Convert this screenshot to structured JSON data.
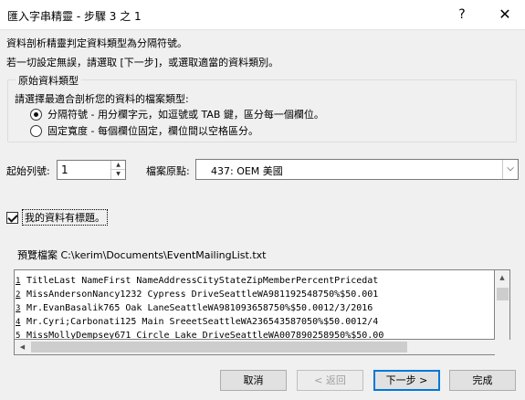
{
  "window": {
    "title": "匯入字串精靈 - 步驟 3 之 1",
    "help_label": "?",
    "close_label": "✕"
  },
  "intro": {
    "line1": "資料剖析精靈判定資料類型為分隔符號。",
    "line2": "若一切設定無誤，請選取 [下一步]，或選取適當的資料類別。"
  },
  "data_type_group": {
    "legend": "原始資料類型",
    "prompt": "請選擇最適合剖析您的資料的檔案類型:",
    "options": [
      {
        "label": "分隔符號 - 用分欄字元，如逗號或 TAB 鍵，區分每一個欄位。",
        "selected": true
      },
      {
        "label": "固定寬度 - 每個欄位固定，欄位間以空格區分。",
        "selected": false
      }
    ]
  },
  "start_row": {
    "label": "起始列號:",
    "value": "1"
  },
  "file_origin": {
    "label": "檔案原點:",
    "value": "437: OEM 美國"
  },
  "header_checkbox": {
    "label": "我的資料有標題。",
    "checked": true
  },
  "preview": {
    "label": "預覽檔案 C:\\kerim\\Documents\\EventMailingList.txt",
    "lines": [
      {
        "num": "1",
        "text": "TitleLast NameFirst NameAddressCityStateZipMemberPercentPricedat"
      },
      {
        "num": "2",
        "text": "MissAndersonNancy1232 Cypress DriveSeattleWA981192548750%$50.001"
      },
      {
        "num": "3",
        "text": "Mr.EvanBasalik765 Oak LaneSeattleWA981093658750%$50.0012/3/2016"
      },
      {
        "num": "4",
        "text": "Mr.Cyri;Carbonati125 Main SreeetSeattleWA236543587050%$50.0012/4"
      },
      {
        "num": "5",
        "text": "MissMollyDempsey671 Circle Lake DriveSeattleWA007890258950%$50.00"
      }
    ]
  },
  "buttons": {
    "cancel": "取消",
    "back": "< 返回",
    "next": "下一步 >",
    "finish": "完成"
  },
  "colors": {
    "accent": "#0078d7",
    "background": "#f0f0f0"
  }
}
